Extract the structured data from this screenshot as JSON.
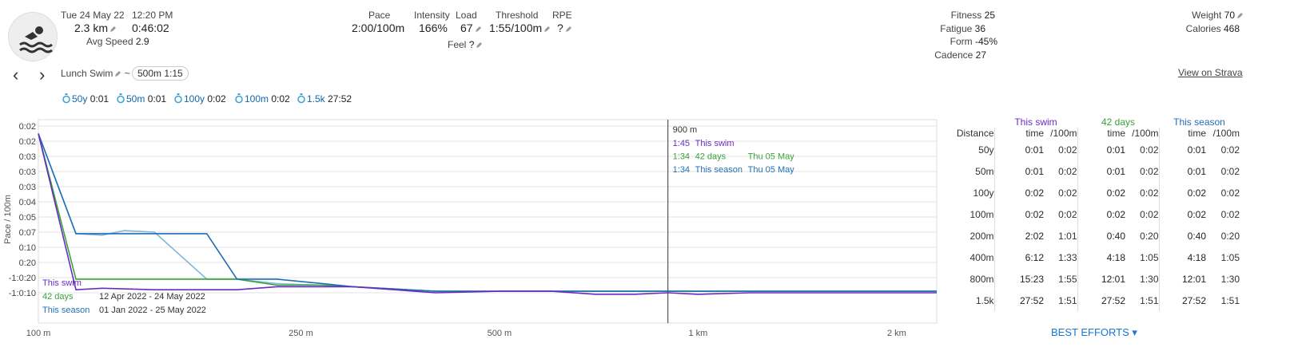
{
  "activity": {
    "date": "Tue 24 May 22",
    "time": "12:20 PM",
    "distance": "2.3 km",
    "duration": "0:46:02",
    "avg_speed_label": "Avg Speed",
    "avg_speed": "2.9"
  },
  "metrics": {
    "pace_label": "Pace",
    "pace": "2:00/100m",
    "intensity_label": "Intensity",
    "intensity": "166%",
    "load_label": "Load",
    "load": "67",
    "threshold_label": "Threshold",
    "threshold": "1:55/100m",
    "rpe_label": "RPE",
    "rpe": "?",
    "feel_label": "Feel",
    "feel": "?"
  },
  "fitness": {
    "fitness_label": "Fitness",
    "fitness": "25",
    "fatigue_label": "Fatigue",
    "fatigue": "36",
    "form_label": "Form",
    "form": "-45%",
    "cadence_label": "Cadence",
    "cadence": "27"
  },
  "body": {
    "weight_label": "Weight",
    "weight": "70",
    "calories_label": "Calories",
    "calories": "468"
  },
  "nav": {
    "prev": "‹",
    "next": "›",
    "name": "Lunch Swim",
    "tilde": "~",
    "chip": "500m 1:15",
    "strava": "View on Strava"
  },
  "best_efforts_chips": [
    {
      "d": "50y",
      "t": "0:01"
    },
    {
      "d": "50m",
      "t": "0:01"
    },
    {
      "d": "100y",
      "t": "0:02"
    },
    {
      "d": "100m",
      "t": "0:02"
    },
    {
      "d": "1.5k",
      "t": "27:52"
    }
  ],
  "chart_data": {
    "type": "line",
    "ylabel": "Pace / 100m",
    "y_ticks": [
      "0:02",
      "0:02",
      "0:03",
      "0:03",
      "0:03",
      "0:04",
      "0:05",
      "0:07",
      "0:10",
      "0:20",
      "-1:0:20",
      "-1:0:10"
    ],
    "x_ticks": [
      "100 m",
      "250 m",
      "500 m",
      "1 km",
      "2 km"
    ],
    "x_log": true,
    "colors": {
      "swim": "#6a2bc4",
      "d42": "#3aa33a",
      "season": "#1f6fb5",
      "season_light": "#7fb6d9"
    },
    "series": [
      {
        "name": "This swim",
        "color": "#6a2bc4",
        "x": [
          100,
          114,
          125,
          150,
          180,
          200,
          230,
          270,
          300,
          400,
          500,
          600,
          700,
          800,
          900,
          1000,
          1200,
          1500,
          2000,
          2300
        ],
        "y": [
          0.5,
          10.8,
          10.7,
          10.8,
          10.8,
          10.8,
          10.6,
          10.6,
          10.6,
          11.0,
          10.9,
          10.9,
          11.1,
          11.1,
          11.0,
          11.1,
          11.0,
          11.0,
          11.0,
          11.0
        ]
      },
      {
        "name": "42 days",
        "color": "#3aa33a",
        "x": [
          100,
          114,
          150,
          180,
          200,
          230,
          270,
          300,
          400,
          500,
          900,
          1200,
          1500,
          2000,
          2300
        ],
        "y": [
          0.5,
          10.1,
          10.1,
          10.1,
          10.1,
          10.5,
          10.5,
          10.6,
          10.9,
          10.9,
          10.9,
          10.9,
          10.9,
          10.9,
          10.9
        ]
      },
      {
        "name": "This season",
        "color": "#1f6fb5",
        "x": [
          100,
          114,
          150,
          180,
          200,
          230,
          270,
          300,
          400,
          500,
          900,
          1200,
          1500,
          2000,
          2300
        ],
        "y": [
          0.5,
          7.1,
          7.1,
          7.1,
          10.1,
          10.1,
          10.4,
          10.6,
          10.9,
          10.9,
          10.9,
          10.9,
          10.9,
          10.9,
          10.9
        ]
      },
      {
        "color": "#7fb6d9",
        "x": [
          100,
          114,
          125,
          135,
          150,
          180,
          200,
          230,
          270,
          300
        ],
        "y": [
          0.5,
          7.1,
          7.2,
          6.9,
          7.0,
          10.1,
          10.1,
          10.4,
          10.5,
          10.6
        ]
      }
    ],
    "cursor": {
      "x": 900,
      "label": "900 m"
    },
    "tooltip": [
      {
        "time": "1:45",
        "name": "This swim",
        "date": ""
      },
      {
        "time": "1:34",
        "name": "42 days",
        "date": "Thu 05 May"
      },
      {
        "time": "1:34",
        "name": "This season",
        "date": "Thu 05 May"
      }
    ],
    "legend": [
      {
        "name": "This swim",
        "range": ""
      },
      {
        "name": "42 days",
        "range": "12 Apr 2022 - 24 May 2022"
      },
      {
        "name": "This season",
        "range": "01 Jan 2022 - 25 May 2022"
      }
    ]
  },
  "efforts_table": {
    "headers": {
      "distance": "Distance",
      "time": "time",
      "per100": "/100m"
    },
    "groups": [
      {
        "name": "This swim",
        "color": "#6a2bc4"
      },
      {
        "name": "42 days",
        "color": "#3aa33a"
      },
      {
        "name": "This season",
        "color": "#1f6fb5"
      }
    ],
    "rows": [
      {
        "d": "50y",
        "v": [
          "0:01",
          "0:02",
          "0:01",
          "0:02",
          "0:01",
          "0:02"
        ]
      },
      {
        "d": "50m",
        "v": [
          "0:01",
          "0:02",
          "0:01",
          "0:02",
          "0:01",
          "0:02"
        ]
      },
      {
        "d": "100y",
        "v": [
          "0:02",
          "0:02",
          "0:02",
          "0:02",
          "0:02",
          "0:02"
        ]
      },
      {
        "d": "100m",
        "v": [
          "0:02",
          "0:02",
          "0:02",
          "0:02",
          "0:02",
          "0:02"
        ]
      },
      {
        "d": "200m",
        "v": [
          "2:02",
          "1:01",
          "0:40",
          "0:20",
          "0:40",
          "0:20"
        ]
      },
      {
        "d": "400m",
        "v": [
          "6:12",
          "1:33",
          "4:18",
          "1:05",
          "4:18",
          "1:05"
        ]
      },
      {
        "d": "800m",
        "v": [
          "15:23",
          "1:55",
          "12:01",
          "1:30",
          "12:01",
          "1:30"
        ]
      },
      {
        "d": "1.5k",
        "v": [
          "27:52",
          "1:51",
          "27:52",
          "1:51",
          "27:52",
          "1:51"
        ]
      }
    ],
    "dropdown": "BEST EFFORTS"
  }
}
